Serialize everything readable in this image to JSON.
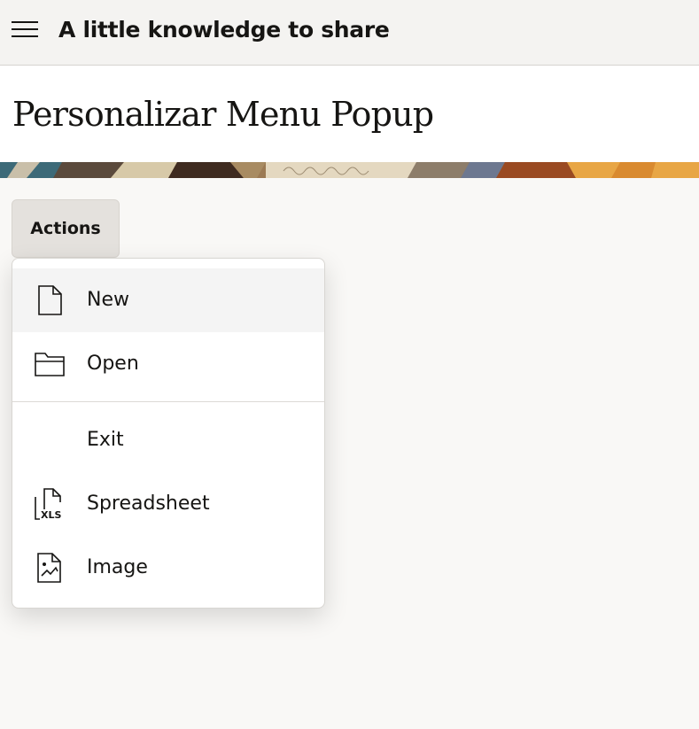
{
  "app": {
    "title": "A little knowledge to share"
  },
  "page": {
    "title": "Personalizar Menu Popup"
  },
  "actions_button": {
    "label": "Actions"
  },
  "menu": {
    "items": [
      {
        "label": "New",
        "icon": "new-document-icon",
        "highlighted": true
      },
      {
        "label": "Open",
        "icon": "folder-open-icon"
      },
      {
        "label": "Exit",
        "icon": null
      },
      {
        "label": "Spreadsheet",
        "icon": "xls-file-icon"
      },
      {
        "label": "Image",
        "icon": "image-file-icon"
      }
    ]
  },
  "colors": {
    "topbar_bg": "#f4f3f1",
    "page_bg": "#f9f8f6",
    "button_bg": "#e4e1dd",
    "highlight_bg": "#f4f4f4",
    "text": "#161513"
  }
}
